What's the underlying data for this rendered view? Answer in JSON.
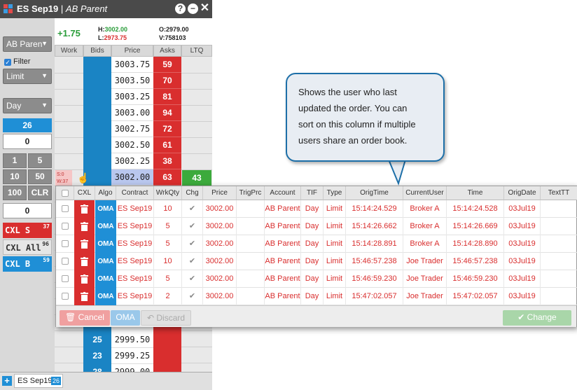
{
  "window": {
    "instrument": "ES Sep19",
    "separator": "|",
    "account": "AB Parent",
    "help_icon": "?",
    "min_icon": "−",
    "close_icon": "✕"
  },
  "left_panel": {
    "account_select": "AB Paren",
    "filter_label": "Filter",
    "order_type": "Limit",
    "tif": "Day",
    "qty_display": "26",
    "qty_input": "0",
    "qty_buttons": [
      "1",
      "5",
      "10",
      "50",
      "100",
      "CLR"
    ],
    "qty_input2": "0",
    "cxl_s": {
      "label": "CXL S",
      "count": "37"
    },
    "cxl_all": {
      "label": "CXL All",
      "count": "96"
    },
    "cxl_b": {
      "label": "CXL B",
      "count": "59"
    }
  },
  "ladder_info": {
    "net_change": "+1.75",
    "high_label": "H:",
    "high": "3002.00",
    "low_label": "L:",
    "low": "2973.75",
    "open_label": "O:",
    "open": "2979.00",
    "vol_label": "V:",
    "volume": "758103"
  },
  "ladder_headers": [
    "Work",
    "Bids",
    "Price",
    "Asks",
    "LTQ"
  ],
  "ladder_rows": [
    {
      "price": "3003.75",
      "ask": "59"
    },
    {
      "price": "3003.50",
      "ask": "70"
    },
    {
      "price": "3003.25",
      "ask": "81"
    },
    {
      "price": "3003.00",
      "ask": "94"
    },
    {
      "price": "3002.75",
      "ask": "72"
    },
    {
      "price": "3002.50",
      "ask": "61"
    },
    {
      "price": "3002.25",
      "ask": "38"
    },
    {
      "price": "3002.00",
      "ask": "63"
    }
  ],
  "ltq_value": "43",
  "work_marker": {
    "s": "S:0",
    "w": "W:37"
  },
  "lower_rows": [
    {
      "bid": "25",
      "price": "2999.50"
    },
    {
      "bid": "23",
      "price": "2999.25"
    },
    {
      "bid": "28",
      "price": "2999.00"
    }
  ],
  "tab": {
    "label": "ES Sep19",
    "count": "26"
  },
  "orders": {
    "headers": [
      "",
      "CXL",
      "Algo",
      "Contract",
      "WrkQty",
      "Chg",
      "Price",
      "TrigPrc",
      "Account",
      "TIF",
      "Type",
      "OrigTime",
      "CurrentUser",
      "Time",
      "OrigDate",
      "TextTT"
    ],
    "rows": [
      {
        "algo": "OMA",
        "contract": "ES Sep19",
        "wrkqty": "10",
        "chg": "✔",
        "price": "3002.00",
        "account": "AB Parent",
        "tif": "Day",
        "type": "Limit",
        "origtime": "15:14:24.529",
        "user": "Broker A",
        "time": "15:14:24.528",
        "origdate": "03Jul19"
      },
      {
        "algo": "OMA",
        "contract": "ES Sep19",
        "wrkqty": "5",
        "chg": "✔",
        "price": "3002.00",
        "account": "AB Parent",
        "tif": "Day",
        "type": "Limit",
        "origtime": "15:14:26.662",
        "user": "Broker A",
        "time": "15:14:26.669",
        "origdate": "03Jul19"
      },
      {
        "algo": "OMA",
        "contract": "ES Sep19",
        "wrkqty": "5",
        "chg": "✔",
        "price": "3002.00",
        "account": "AB Parent",
        "tif": "Day",
        "type": "Limit",
        "origtime": "15:14:28.891",
        "user": "Broker A",
        "time": "15:14:28.890",
        "origdate": "03Jul19"
      },
      {
        "algo": "OMA",
        "contract": "ES Sep19",
        "wrkqty": "10",
        "chg": "✔",
        "price": "3002.00",
        "account": "AB Parent",
        "tif": "Day",
        "type": "Limit",
        "origtime": "15:46:57.238",
        "user": "Joe Trader",
        "time": "15:46:57.238",
        "origdate": "03Jul19"
      },
      {
        "algo": "OMA",
        "contract": "ES Sep19",
        "wrkqty": "5",
        "chg": "✔",
        "price": "3002.00",
        "account": "AB Parent",
        "tif": "Day",
        "type": "Limit",
        "origtime": "15:46:59.230",
        "user": "Joe Trader",
        "time": "15:46:59.230",
        "origdate": "03Jul19"
      },
      {
        "algo": "OMA",
        "contract": "ES Sep19",
        "wrkqty": "2",
        "chg": "✔",
        "price": "3002.00",
        "account": "AB Parent",
        "tif": "Day",
        "type": "Limit",
        "origtime": "15:47:02.057",
        "user": "Joe Trader",
        "time": "15:47:02.057",
        "origdate": "03Jul19"
      }
    ],
    "footer": {
      "cancel": "Cancel",
      "oma": "OMA",
      "discard": "Discard",
      "change": "Change"
    }
  },
  "callout": {
    "lines": [
      "Shows the user who last",
      "updated the order. You can",
      "sort on this column if multiple",
      "users share an order book."
    ]
  },
  "colors": {
    "bid_blue": "#1a84c4",
    "ask_red": "#d92e2e",
    "ltq_green": "#3caa3c",
    "accent_blue": "#1f8fd6"
  }
}
